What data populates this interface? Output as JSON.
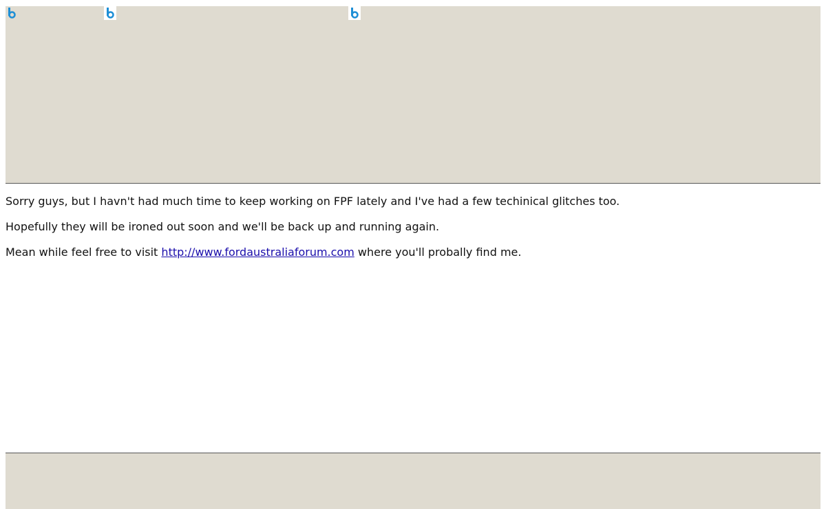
{
  "header": {
    "images": [
      {
        "icon": "broken-image-icon"
      },
      {
        "icon": "broken-image-icon"
      },
      {
        "icon": "broken-image-icon"
      }
    ]
  },
  "content": {
    "line1": "Sorry guys, but I havn't had much time to keep working on FPF lately and I've had a few techinical glitches too.",
    "line2": "Hopefully they will be ironed out soon and we'll be back up and running again.",
    "line3_prefix": "Mean while feel free to visit ",
    "link_text": "http://www.fordaustraliaforum.com",
    "line3_suffix": " where you'll probally find me."
  },
  "colors": {
    "banner_bg": "#dfdbd0",
    "link": "#1a0dab",
    "icon_blue": "#1e8fd6"
  }
}
